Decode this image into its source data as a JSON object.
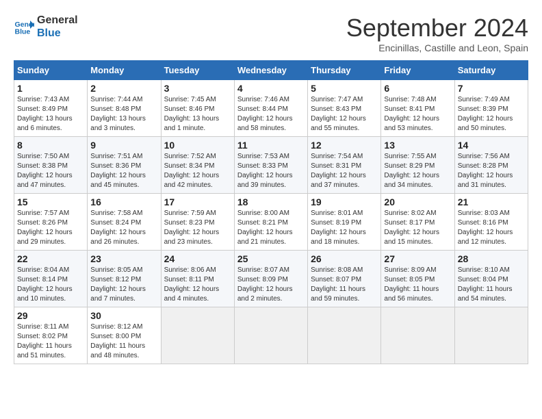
{
  "header": {
    "logo_line1": "General",
    "logo_line2": "Blue",
    "month": "September 2024",
    "location": "Encinillas, Castille and Leon, Spain"
  },
  "days_of_week": [
    "Sunday",
    "Monday",
    "Tuesday",
    "Wednesday",
    "Thursday",
    "Friday",
    "Saturday"
  ],
  "weeks": [
    [
      {
        "num": "1",
        "rise": "7:43 AM",
        "set": "8:49 PM",
        "daylight": "13 hours and 6 minutes."
      },
      {
        "num": "2",
        "rise": "7:44 AM",
        "set": "8:48 PM",
        "daylight": "13 hours and 3 minutes."
      },
      {
        "num": "3",
        "rise": "7:45 AM",
        "set": "8:46 PM",
        "daylight": "13 hours and 1 minute."
      },
      {
        "num": "4",
        "rise": "7:46 AM",
        "set": "8:44 PM",
        "daylight": "12 hours and 58 minutes."
      },
      {
        "num": "5",
        "rise": "7:47 AM",
        "set": "8:43 PM",
        "daylight": "12 hours and 55 minutes."
      },
      {
        "num": "6",
        "rise": "7:48 AM",
        "set": "8:41 PM",
        "daylight": "12 hours and 53 minutes."
      },
      {
        "num": "7",
        "rise": "7:49 AM",
        "set": "8:39 PM",
        "daylight": "12 hours and 50 minutes."
      }
    ],
    [
      {
        "num": "8",
        "rise": "7:50 AM",
        "set": "8:38 PM",
        "daylight": "12 hours and 47 minutes."
      },
      {
        "num": "9",
        "rise": "7:51 AM",
        "set": "8:36 PM",
        "daylight": "12 hours and 45 minutes."
      },
      {
        "num": "10",
        "rise": "7:52 AM",
        "set": "8:34 PM",
        "daylight": "12 hours and 42 minutes."
      },
      {
        "num": "11",
        "rise": "7:53 AM",
        "set": "8:33 PM",
        "daylight": "12 hours and 39 minutes."
      },
      {
        "num": "12",
        "rise": "7:54 AM",
        "set": "8:31 PM",
        "daylight": "12 hours and 37 minutes."
      },
      {
        "num": "13",
        "rise": "7:55 AM",
        "set": "8:29 PM",
        "daylight": "12 hours and 34 minutes."
      },
      {
        "num": "14",
        "rise": "7:56 AM",
        "set": "8:28 PM",
        "daylight": "12 hours and 31 minutes."
      }
    ],
    [
      {
        "num": "15",
        "rise": "7:57 AM",
        "set": "8:26 PM",
        "daylight": "12 hours and 29 minutes."
      },
      {
        "num": "16",
        "rise": "7:58 AM",
        "set": "8:24 PM",
        "daylight": "12 hours and 26 minutes."
      },
      {
        "num": "17",
        "rise": "7:59 AM",
        "set": "8:23 PM",
        "daylight": "12 hours and 23 minutes."
      },
      {
        "num": "18",
        "rise": "8:00 AM",
        "set": "8:21 PM",
        "daylight": "12 hours and 21 minutes."
      },
      {
        "num": "19",
        "rise": "8:01 AM",
        "set": "8:19 PM",
        "daylight": "12 hours and 18 minutes."
      },
      {
        "num": "20",
        "rise": "8:02 AM",
        "set": "8:17 PM",
        "daylight": "12 hours and 15 minutes."
      },
      {
        "num": "21",
        "rise": "8:03 AM",
        "set": "8:16 PM",
        "daylight": "12 hours and 12 minutes."
      }
    ],
    [
      {
        "num": "22",
        "rise": "8:04 AM",
        "set": "8:14 PM",
        "daylight": "12 hours and 10 minutes."
      },
      {
        "num": "23",
        "rise": "8:05 AM",
        "set": "8:12 PM",
        "daylight": "12 hours and 7 minutes."
      },
      {
        "num": "24",
        "rise": "8:06 AM",
        "set": "8:11 PM",
        "daylight": "12 hours and 4 minutes."
      },
      {
        "num": "25",
        "rise": "8:07 AM",
        "set": "8:09 PM",
        "daylight": "12 hours and 2 minutes."
      },
      {
        "num": "26",
        "rise": "8:08 AM",
        "set": "8:07 PM",
        "daylight": "11 hours and 59 minutes."
      },
      {
        "num": "27",
        "rise": "8:09 AM",
        "set": "8:05 PM",
        "daylight": "11 hours and 56 minutes."
      },
      {
        "num": "28",
        "rise": "8:10 AM",
        "set": "8:04 PM",
        "daylight": "11 hours and 54 minutes."
      }
    ],
    [
      {
        "num": "29",
        "rise": "8:11 AM",
        "set": "8:02 PM",
        "daylight": "11 hours and 51 minutes."
      },
      {
        "num": "30",
        "rise": "8:12 AM",
        "set": "8:00 PM",
        "daylight": "11 hours and 48 minutes."
      },
      null,
      null,
      null,
      null,
      null
    ]
  ]
}
